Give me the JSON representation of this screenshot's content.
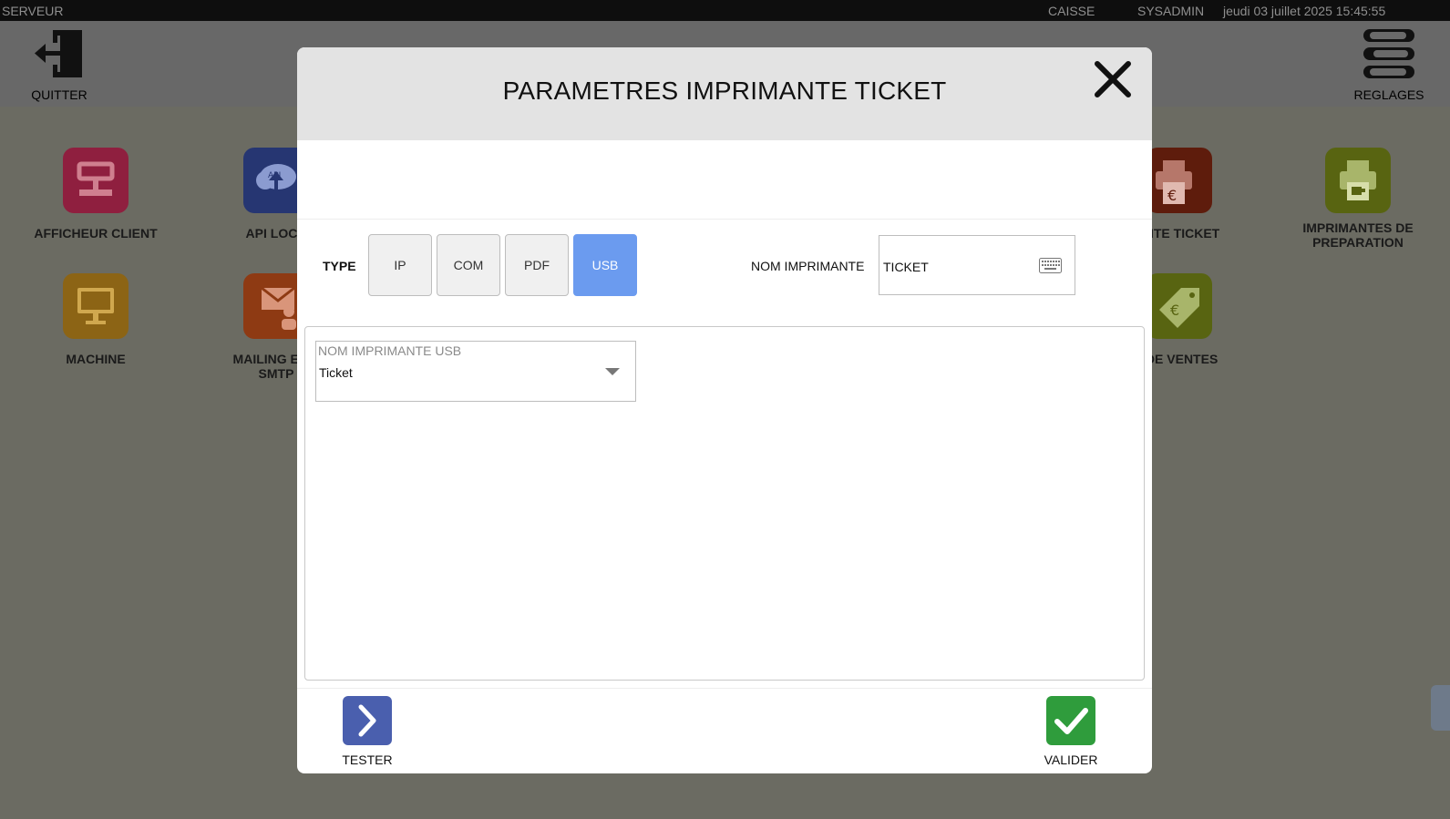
{
  "topbar": {
    "left": "SERVEUR",
    "caisse": "CAISSE",
    "user": "SYSADMIN",
    "datetime": "jeudi 03 juillet 2025   15:45:55"
  },
  "header": {
    "quit_label": "QUITTER",
    "settings_label": "REGLAGES"
  },
  "tiles": {
    "afficheur": "AFFICHEUR CLIENT",
    "api": "API LOCA",
    "api_badge": "API",
    "machine": "MACHINE",
    "mailing_line1": "MAILING ET C",
    "mailing_line2": "SMTP",
    "imprimante_ticket": "IANTE TICKET",
    "imprimantes_prep_line1": "IMPRIMANTES DE",
    "imprimantes_prep_line2": "PREPARATION",
    "ventes": "S DE VENTES"
  },
  "modal": {
    "title": "PARAMETRES IMPRIMANTE TICKET",
    "type_label": "TYPE",
    "type_options": [
      "IP",
      "COM",
      "PDF",
      "USB"
    ],
    "selected_type": "USB",
    "printer_name_label": "NOM IMPRIMANTE",
    "printer_name_value": "TICKET",
    "usb_select": {
      "placeholder": "NOM IMPRIMANTE USB",
      "value": "Ticket"
    },
    "test_label": "TESTER",
    "validate_label": "VALIDER"
  },
  "colors": {
    "selected_type": "#6b9bef",
    "test_button": "#4a5fae",
    "validate_button": "#2f9c3c",
    "overlay": "#6b6b62"
  },
  "icons": {
    "quit": "exit-door-icon",
    "settings": "toggles-icon",
    "close": "close-icon",
    "keyboard": "keyboard-icon",
    "dropdown": "chevron-down-icon",
    "test": "chevron-right-icon",
    "validate": "check-icon"
  }
}
